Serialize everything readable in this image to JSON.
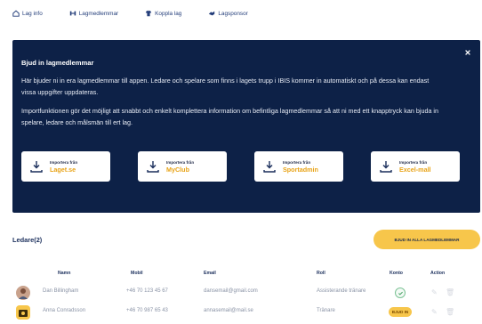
{
  "tabs": [
    {
      "label": "Lag info",
      "icon": "team-info-icon"
    },
    {
      "label": "Lagmedlemmar",
      "icon": "members-icon"
    },
    {
      "label": "Koppla lag",
      "icon": "link-team-icon"
    },
    {
      "label": "Lagsponsor",
      "icon": "sponsor-icon"
    }
  ],
  "banner": {
    "title": "Bjud in lagmedlemmar",
    "p1": "Här bjuder ni in era lagmedlemmar till appen. Ledare och spelare som finns i lagets trupp i IBIS kommer in automatiskt och på dessa kan endast vissa uppgifter uppdateras.",
    "p2": "Importfunktionen gör det möjligt att snabbt och enkelt komplettera information om befintliga lagmedlemmar så att ni med ett knapptryck kan bjuda in spelare, ledare och målsmän till ert lag.",
    "import_prefix": "Importera från",
    "sources": [
      "Laget.se",
      "MyClub",
      "Sportadmin",
      "Excel-mall"
    ]
  },
  "leaders": {
    "title": "Ledare(2)",
    "invite_all": "BJUD IN ALLA LAGMEDLEMMAR",
    "columns": [
      "Namn",
      "Mobil",
      "Email",
      "Roll",
      "Konto",
      "Action"
    ],
    "rows": [
      {
        "name": "Dan Billingham",
        "mobile": "+46 70 123 45 67",
        "email": "dansemail@gmail.com",
        "role": "Assisterande tränare",
        "status": "active"
      },
      {
        "name": "Anna Conradsson",
        "mobile": "+46 70 987 65 43",
        "email": "annasemail@mail.se",
        "role": "Tränare",
        "status": "invite",
        "invite_label": "BJUD IN"
      }
    ]
  },
  "colors": {
    "banner_bg": "#0d2147",
    "accent": "#f7c64b",
    "source_text": "#e8a317"
  }
}
